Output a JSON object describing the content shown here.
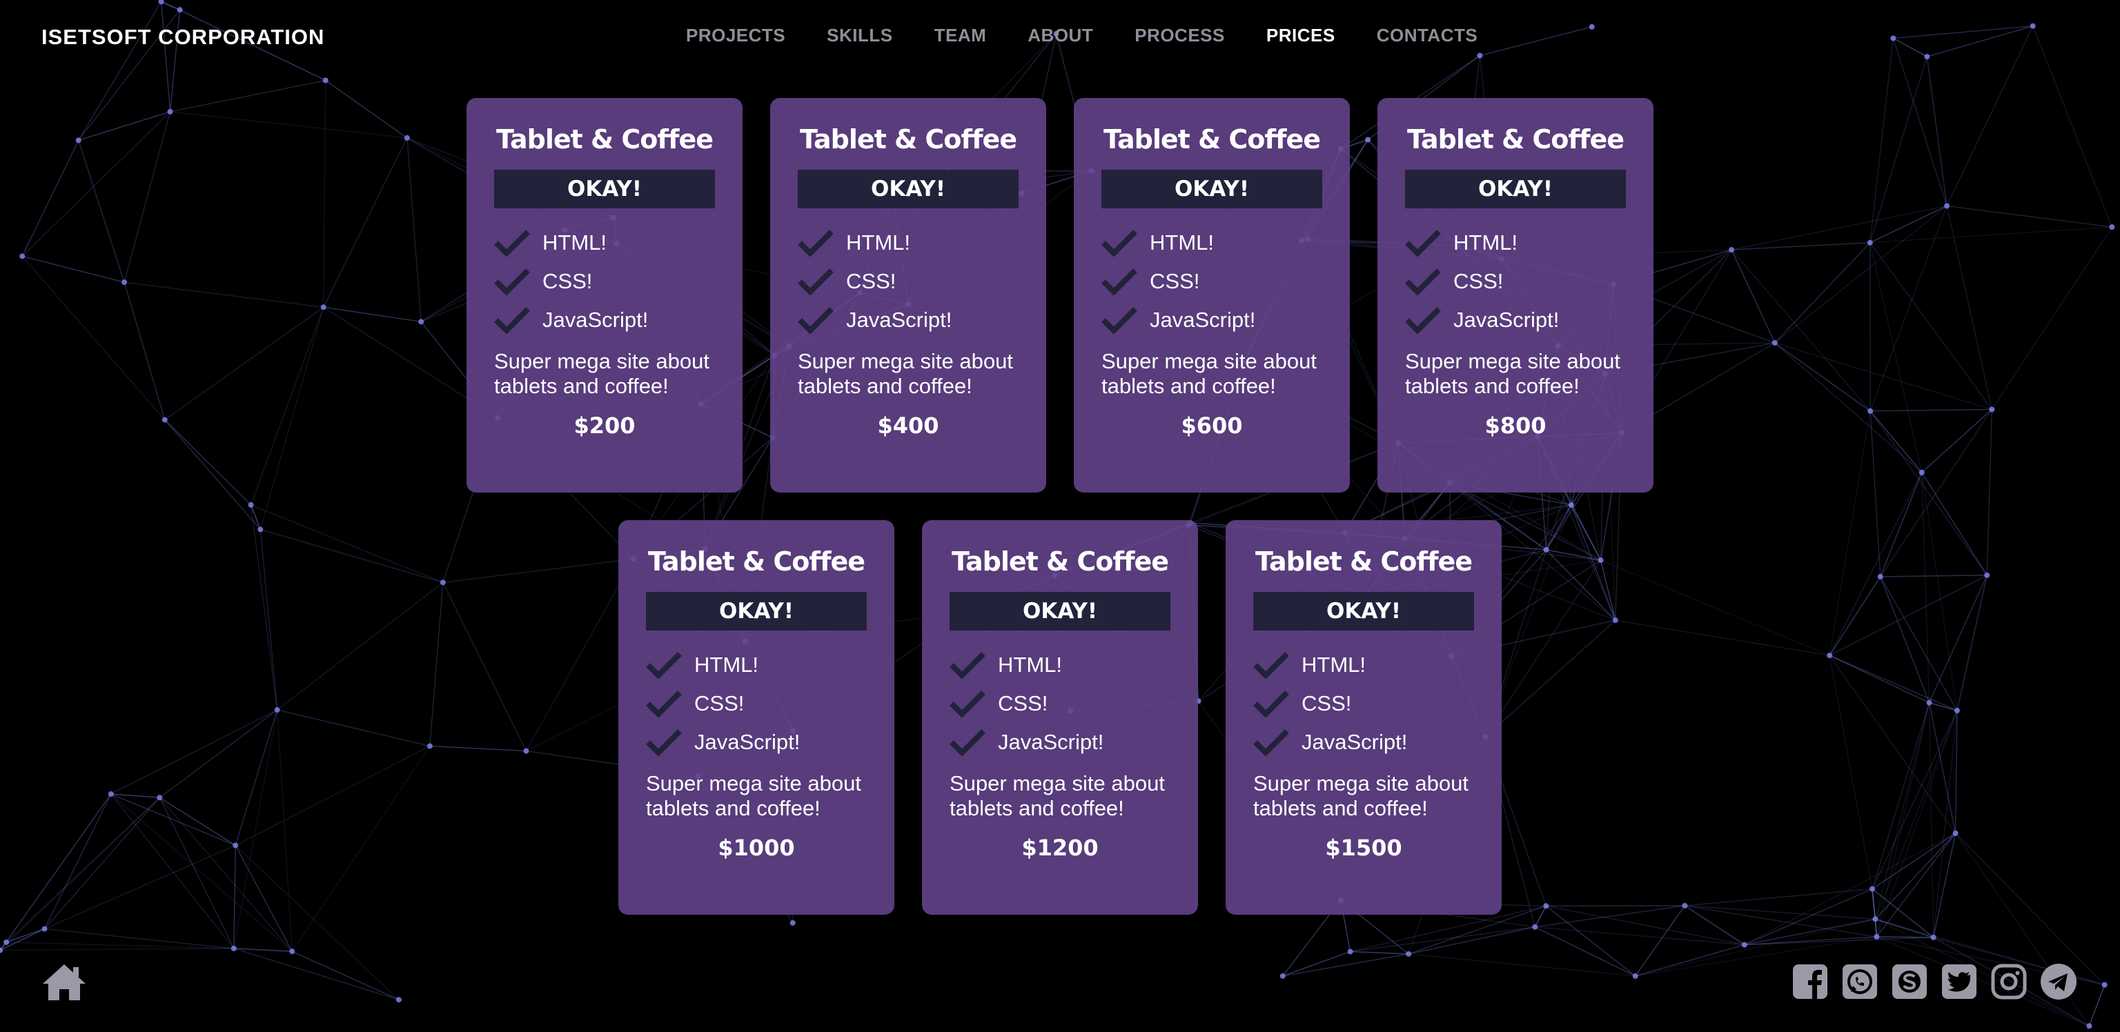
{
  "brand": "ISETSOFT CORPORATION",
  "nav": [
    {
      "label": "PROJECTS",
      "active": false
    },
    {
      "label": "SKILLS",
      "active": false
    },
    {
      "label": "TEAM",
      "active": false
    },
    {
      "label": "ABOUT",
      "active": false
    },
    {
      "label": "PROCESS",
      "active": false
    },
    {
      "label": "PRICES",
      "active": true
    },
    {
      "label": "CONTACTS",
      "active": false
    }
  ],
  "cards": [
    {
      "title": "Tablet & Coffee",
      "badge": "OKAY!",
      "features": [
        "HTML!",
        "CSS!",
        "JavaScript!"
      ],
      "description": "Super mega site about tablets and coffee!",
      "price": "$200"
    },
    {
      "title": "Tablet & Coffee",
      "badge": "OKAY!",
      "features": [
        "HTML!",
        "CSS!",
        "JavaScript!"
      ],
      "description": "Super mega site about tablets and coffee!",
      "price": "$400"
    },
    {
      "title": "Tablet & Coffee",
      "badge": "OKAY!",
      "features": [
        "HTML!",
        "CSS!",
        "JavaScript!"
      ],
      "description": "Super mega site about tablets and coffee!",
      "price": "$600"
    },
    {
      "title": "Tablet & Coffee",
      "badge": "OKAY!",
      "features": [
        "HTML!",
        "CSS!",
        "JavaScript!"
      ],
      "description": "Super mega site about tablets and coffee!",
      "price": "$800"
    },
    {
      "title": "Tablet & Coffee",
      "badge": "OKAY!",
      "features": [
        "HTML!",
        "CSS!",
        "JavaScript!"
      ],
      "description": "Super mega site about tablets and coffee!",
      "price": "$1000"
    },
    {
      "title": "Tablet & Coffee",
      "badge": "OKAY!",
      "features": [
        "HTML!",
        "CSS!",
        "JavaScript!"
      ],
      "description": "Super mega site about tablets and coffee!",
      "price": "$1200"
    },
    {
      "title": "Tablet & Coffee",
      "badge": "OKAY!",
      "features": [
        "HTML!",
        "CSS!",
        "JavaScript!"
      ],
      "description": "Super mega site about tablets and coffee!",
      "price": "$1500"
    }
  ],
  "footer": {
    "home_icon": "home-icon",
    "social_icons": [
      "facebook-icon",
      "whatsapp-icon",
      "skype-icon",
      "twitter-icon",
      "instagram-icon",
      "telegram-icon"
    ]
  },
  "colors": {
    "background": "#000000",
    "card": "#64448c",
    "badge": "#22223a",
    "network": "#7b83e6",
    "nav_inactive": "#8f8f99",
    "nav_active": "#ffffff",
    "icon": "#9a9aa6"
  }
}
